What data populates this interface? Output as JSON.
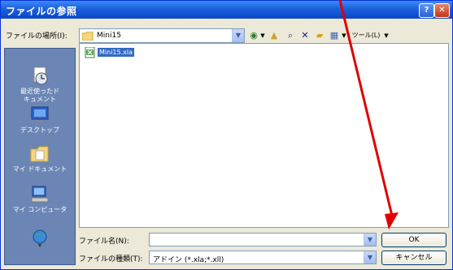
{
  "window": {
    "title": "ファイルの参照",
    "help_label": "?",
    "close_label": "✕"
  },
  "location": {
    "label": "ファイルの場所(I):",
    "value": "Mini15"
  },
  "toolbar": {
    "tools_label": "ツール(L)"
  },
  "places": [
    {
      "label1": "最近使ったド",
      "label2": "キュメント",
      "icon": "recent-documents-icon"
    },
    {
      "label1": "デスクトップ",
      "label2": "",
      "icon": "desktop-icon"
    },
    {
      "label1": "マイ ドキュメント",
      "label2": "",
      "icon": "my-documents-icon"
    },
    {
      "label1": "マイ コンピュータ",
      "label2": "",
      "icon": "my-computer-icon"
    },
    {
      "label1": "",
      "label2": "",
      "icon": "my-network-icon"
    }
  ],
  "files": [
    {
      "name": "Mini15.xla",
      "icon": "excel-addin-icon"
    }
  ],
  "filename": {
    "label": "ファイル名(N):",
    "value": ""
  },
  "filetype": {
    "label": "ファイルの種類(T):",
    "value": "アドイン (*.xla;*.xll)"
  },
  "buttons": {
    "ok": "OK",
    "cancel": "キャンセル"
  },
  "annotation": {
    "arrow_color": "#e00000"
  }
}
